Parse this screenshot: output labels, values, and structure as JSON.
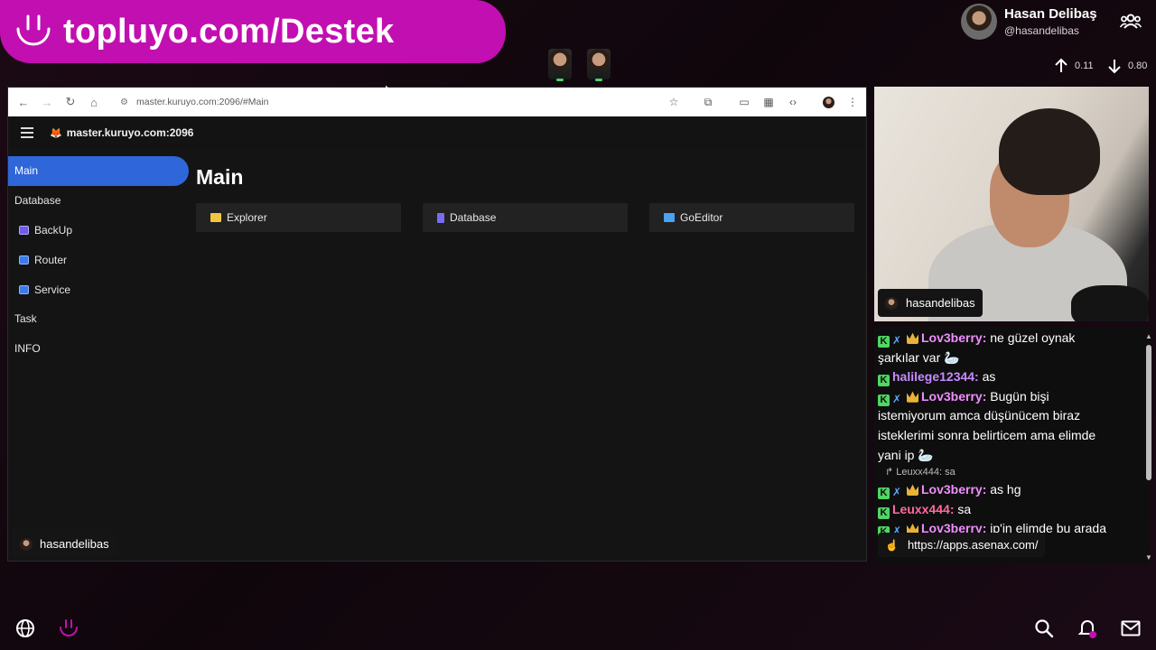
{
  "banner": {
    "text": "topluyo.com/Destek"
  },
  "profile": {
    "name": "Hasan Delibaş",
    "handle": "@hasandelibas"
  },
  "stats": {
    "up": "0.11",
    "down": "0.80"
  },
  "browser": {
    "url": "master.kuruyo.com:2096/#Main",
    "app_host": "master.kuruyo.com:2096",
    "sidebar": [
      {
        "label": "Main"
      },
      {
        "label": "Database"
      },
      {
        "label": "BackUp"
      },
      {
        "label": "Router"
      },
      {
        "label": "Service"
      },
      {
        "label": "Task"
      },
      {
        "label": "INFO"
      }
    ],
    "page_title": "Main",
    "cards": [
      {
        "label": "Explorer",
        "icon": "folder-icon"
      },
      {
        "label": "Database",
        "icon": "database-icon"
      },
      {
        "label": "GoEditor",
        "icon": "monitor-icon"
      }
    ]
  },
  "user_tag": "hasandelibas",
  "cam_tag": "hasandelibas",
  "chat": {
    "messages": [
      {
        "user": "Lov3berry:",
        "text": "ne güzel oynak"
      },
      {
        "text": "şarkılar var 🦢"
      },
      {
        "user": "halilege12344:",
        "text": "as"
      },
      {
        "user": "Lov3berry:",
        "text": "Bugün bişi"
      },
      {
        "text": "istemiyorum amca düşünücem biraz"
      },
      {
        "text": "isteklerimi sonra belirticem ama elimde"
      },
      {
        "text": "yani ip 🦢"
      },
      {
        "reply": "Leuxx444: sa"
      },
      {
        "user": "Lov3berry:",
        "text": "as hg"
      },
      {
        "user": "Leuxx444:",
        "text": "sa"
      },
      {
        "user": "Lov3berry:",
        "text": "ip'in elimde bu arada"
      }
    ],
    "link": "https://apps.asenax.com/"
  },
  "colors": {
    "accent": "#c20fb1",
    "active": "#2f66d9"
  }
}
